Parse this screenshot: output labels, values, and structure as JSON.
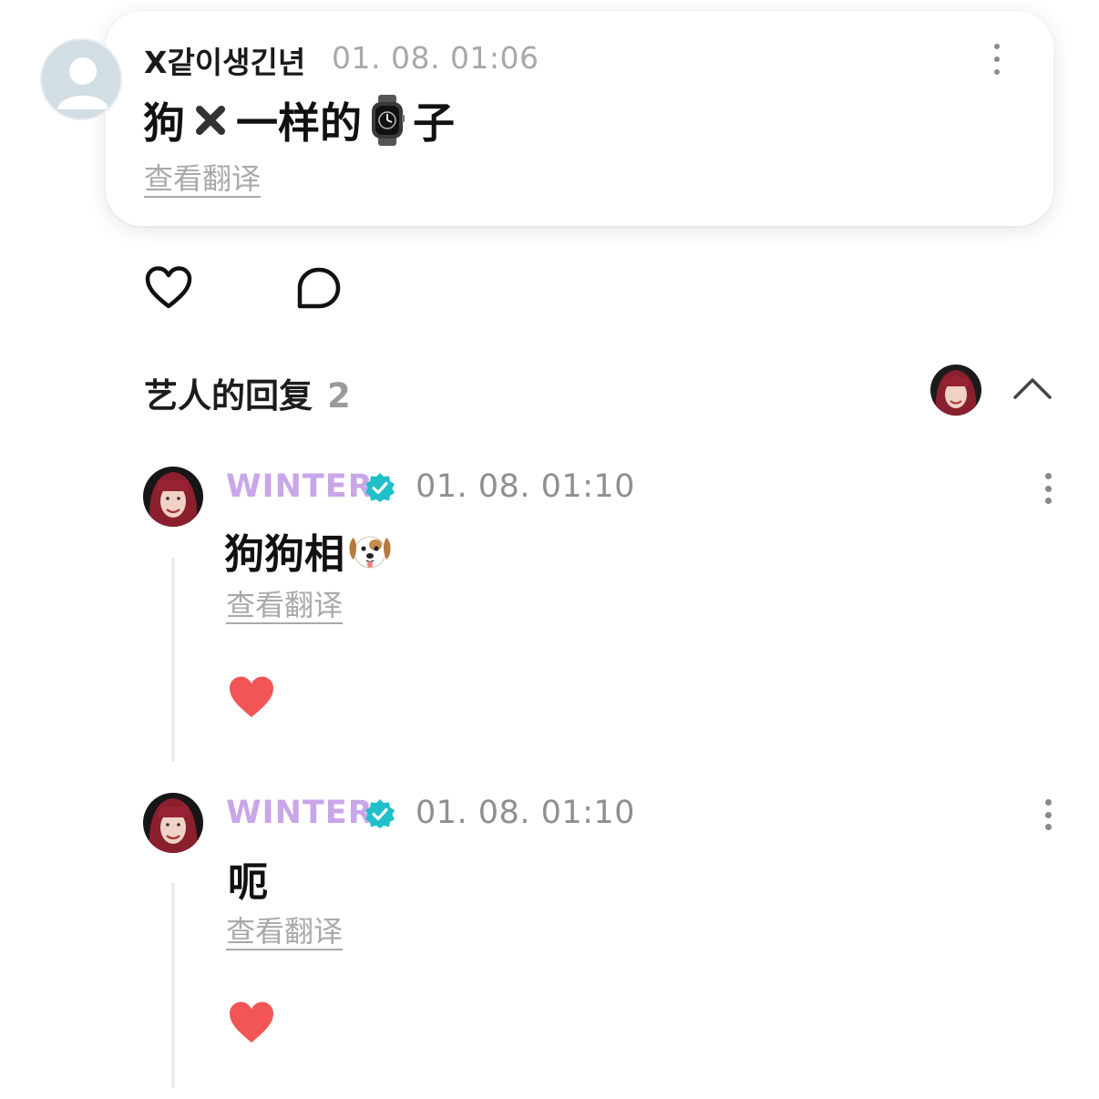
{
  "post": {
    "author": "X같이생긴년",
    "time": "01. 08. 01:06",
    "text_before": "狗",
    "text_middle": "一样的",
    "text_after": "子",
    "emoji_1": "cross-mark-icon",
    "emoji_2": "watch-icon",
    "translate_label": "查看翻译"
  },
  "actions": {
    "like_icon": "heart-outline-icon",
    "comment_icon": "comment-bubble-icon"
  },
  "replies_section": {
    "title": "艺人的回复",
    "count": "2"
  },
  "replies": [
    {
      "name": "WINTER",
      "time": "01. 08. 01:10",
      "text": "狗狗相",
      "emoji": "dog-face-icon",
      "translate_label": "查看翻译",
      "liked": true
    },
    {
      "name": "WINTER",
      "time": "01. 08. 01:10",
      "text": "呃",
      "translate_label": "查看翻译",
      "liked": true
    }
  ],
  "colors": {
    "artist_name": "#c9a6e8",
    "verified_badge": "#1fc0c9",
    "heart_red": "#f25555",
    "muted_text": "#a9a9a9"
  }
}
